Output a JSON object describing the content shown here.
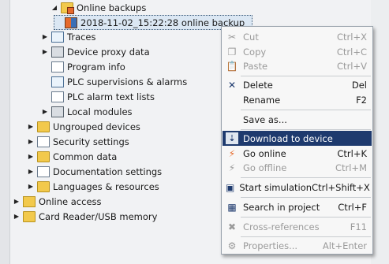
{
  "tree": {
    "rows": [
      {
        "label": "Online backups",
        "icon": "online-backups-icon",
        "arrow": "expanded"
      },
      {
        "label": "2018-11-02_15:22:28 online backup",
        "icon": "backup-file-icon",
        "arrow": "none"
      },
      {
        "label": "Traces",
        "icon": "traces-icon",
        "arrow": "collapsed"
      },
      {
        "label": "Device proxy data",
        "icon": "device-proxy-icon",
        "arrow": "collapsed"
      },
      {
        "label": "Program info",
        "icon": "program-info-icon",
        "arrow": "none"
      },
      {
        "label": "PLC supervisions & alarms",
        "icon": "plc-supervision-icon",
        "arrow": "none"
      },
      {
        "label": "PLC alarm text lists",
        "icon": "alarm-text-list-icon",
        "arrow": "none"
      },
      {
        "label": "Local modules",
        "icon": "local-modules-icon",
        "arrow": "collapsed"
      },
      {
        "label": "Ungrouped devices",
        "icon": "folder-icon",
        "arrow": "collapsed"
      },
      {
        "label": "Security settings",
        "icon": "security-icon",
        "arrow": "collapsed"
      },
      {
        "label": "Common data",
        "icon": "common-data-icon",
        "arrow": "collapsed"
      },
      {
        "label": "Documentation settings",
        "icon": "documentation-icon",
        "arrow": "collapsed"
      },
      {
        "label": "Languages & resources",
        "icon": "languages-icon",
        "arrow": "collapsed"
      },
      {
        "label": "Online access",
        "icon": "online-access-icon",
        "arrow": "collapsed"
      },
      {
        "label": "Card Reader/USB memory",
        "icon": "card-reader-icon",
        "arrow": "collapsed"
      }
    ]
  },
  "menu": {
    "items": [
      {
        "label": "Cut",
        "shortcut": "Ctrl+X",
        "disabled": true,
        "icon": "scissors-icon"
      },
      {
        "label": "Copy",
        "shortcut": "Ctrl+C",
        "disabled": true,
        "icon": "copy-icon"
      },
      {
        "label": "Paste",
        "shortcut": "Ctrl+V",
        "disabled": true,
        "icon": "paste-icon"
      },
      {
        "label": "Delete",
        "shortcut": "Del",
        "disabled": false,
        "icon": "delete-x-icon"
      },
      {
        "label": "Rename",
        "shortcut": "F2",
        "disabled": false,
        "icon": ""
      },
      {
        "label": "Save as...",
        "shortcut": "",
        "disabled": false,
        "icon": ""
      },
      {
        "label": "Download to device",
        "shortcut": "",
        "disabled": false,
        "highlight": true,
        "icon": "download-icon"
      },
      {
        "label": "Go online",
        "shortcut": "Ctrl+K",
        "disabled": false,
        "icon": "go-online-icon"
      },
      {
        "label": "Go offline",
        "shortcut": "Ctrl+M",
        "disabled": true,
        "icon": "go-offline-icon"
      },
      {
        "label": "Start simulation",
        "shortcut": "Ctrl+Shift+X",
        "disabled": false,
        "icon": "simulation-icon"
      },
      {
        "label": "Search in project",
        "shortcut": "Ctrl+F",
        "disabled": false,
        "icon": "search-project-icon"
      },
      {
        "label": "Cross-references",
        "shortcut": "F11",
        "disabled": true,
        "icon": "cross-references-icon"
      },
      {
        "label": "Properties...",
        "shortcut": "Alt+Enter",
        "disabled": true,
        "icon": "properties-icon"
      }
    ]
  },
  "colors": {
    "highlight": "#1e3a6e",
    "selection": "#dbe7f3"
  }
}
